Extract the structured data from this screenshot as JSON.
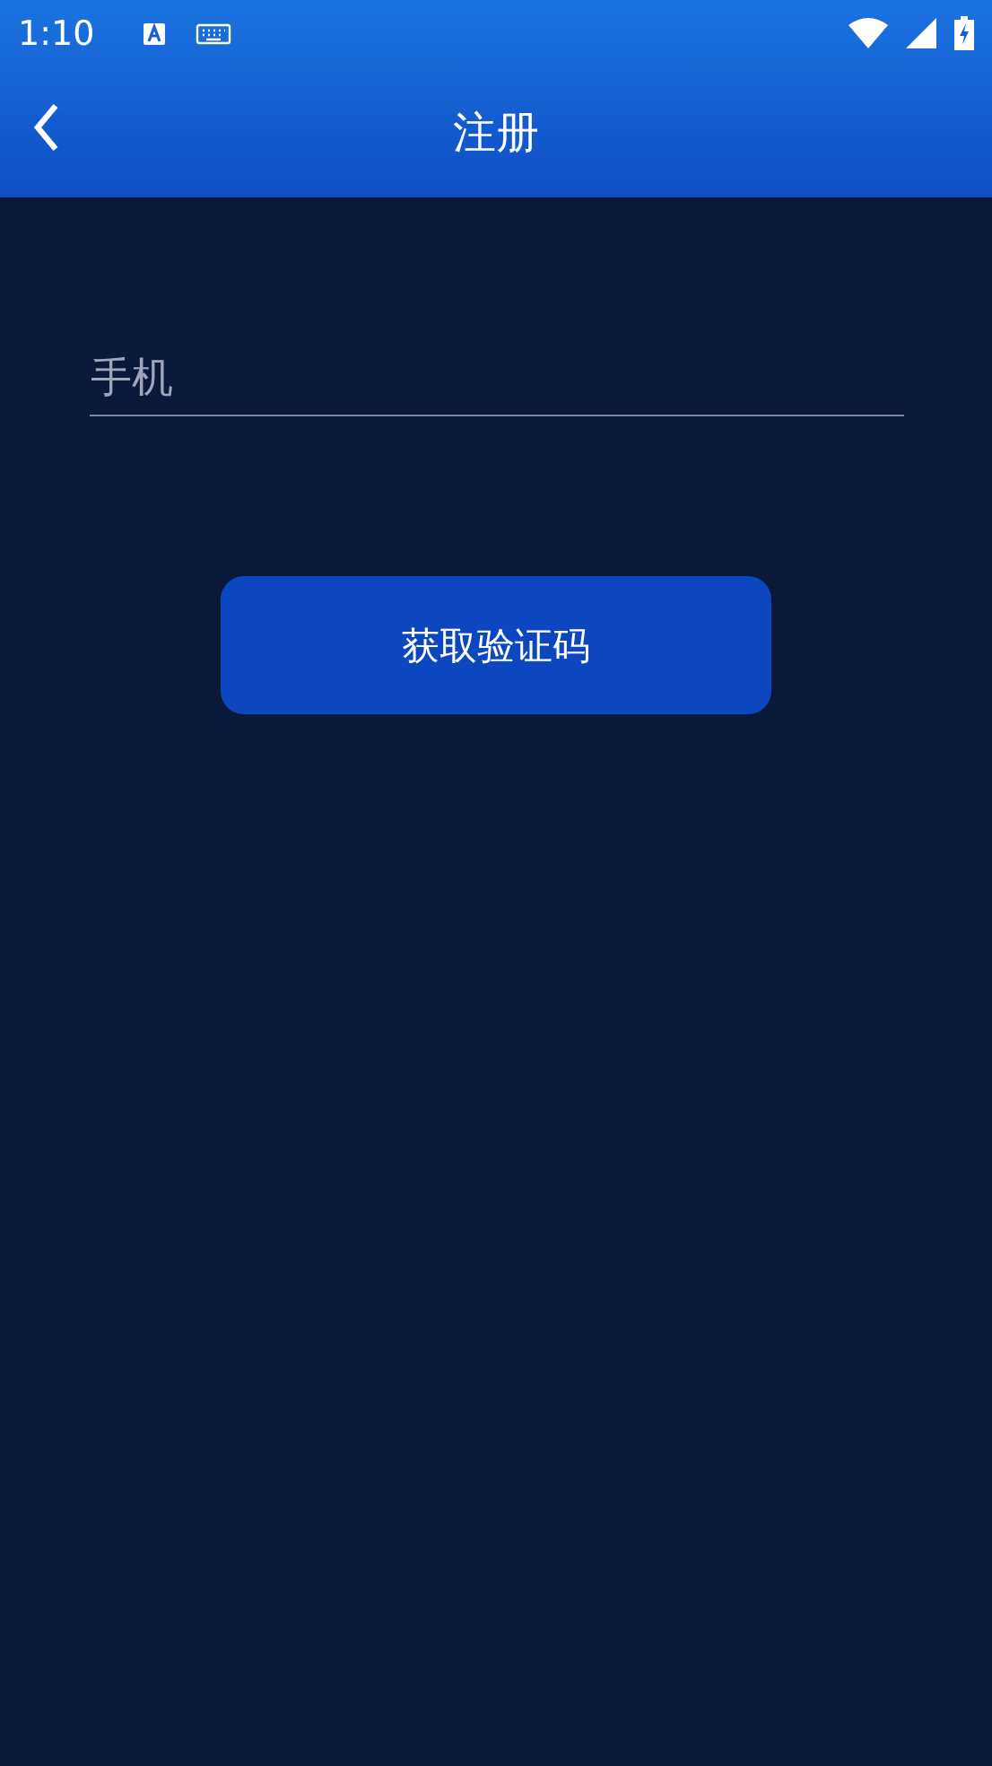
{
  "status_bar": {
    "time": "1:10"
  },
  "header": {
    "title": "注册"
  },
  "phone_field": {
    "placeholder": "手机"
  },
  "code_button": {
    "label": "获取验证码"
  }
}
